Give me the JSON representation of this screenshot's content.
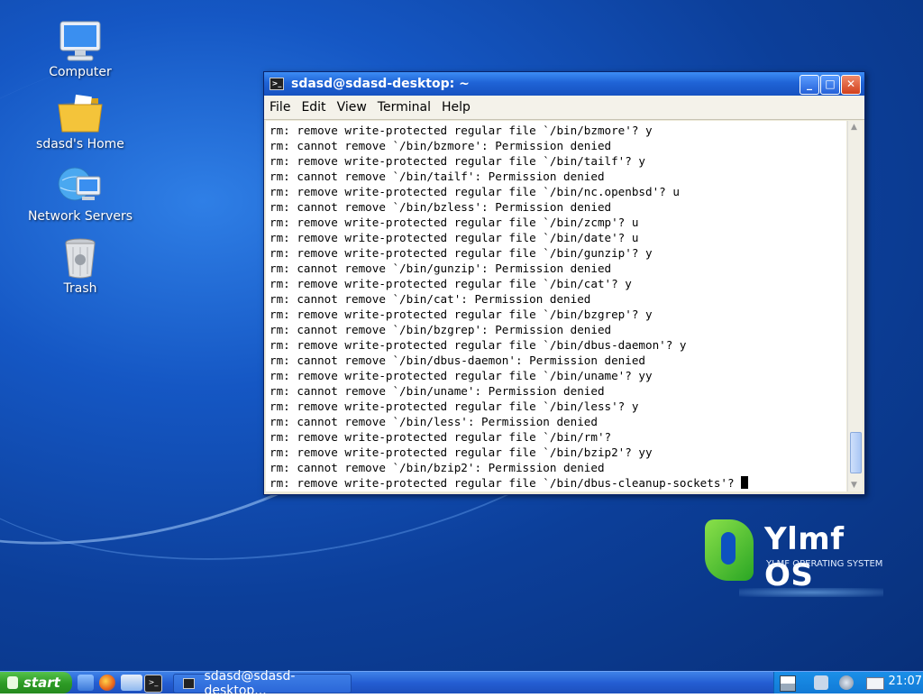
{
  "desktop": {
    "icons": [
      {
        "label": "Computer"
      },
      {
        "label": "sdasd's Home"
      },
      {
        "label": "Network Servers"
      },
      {
        "label": "Trash"
      }
    ]
  },
  "window": {
    "title": "sdasd@sdasd-desktop: ~",
    "menu": [
      "File",
      "Edit",
      "View",
      "Terminal",
      "Help"
    ],
    "buttons": {
      "minimize": "_",
      "maximize": "□",
      "close": "✕"
    }
  },
  "terminal": {
    "lines": [
      "rm: remove write-protected regular file `/bin/bzmore'? y",
      "rm: cannot remove `/bin/bzmore': Permission denied",
      "rm: remove write-protected regular file `/bin/tailf'? y",
      "rm: cannot remove `/bin/tailf': Permission denied",
      "rm: remove write-protected regular file `/bin/nc.openbsd'? u",
      "rm: cannot remove `/bin/bzless': Permission denied",
      "rm: remove write-protected regular file `/bin/zcmp'? u",
      "rm: remove write-protected regular file `/bin/date'? u",
      "rm: remove write-protected regular file `/bin/gunzip'? y",
      "rm: cannot remove `/bin/gunzip': Permission denied",
      "rm: remove write-protected regular file `/bin/cat'? y",
      "rm: cannot remove `/bin/cat': Permission denied",
      "rm: remove write-protected regular file `/bin/bzgrep'? y",
      "rm: cannot remove `/bin/bzgrep': Permission denied",
      "rm: remove write-protected regular file `/bin/dbus-daemon'? y",
      "rm: cannot remove `/bin/dbus-daemon': Permission denied",
      "rm: remove write-protected regular file `/bin/uname'? yy",
      "rm: cannot remove `/bin/uname': Permission denied",
      "rm: remove write-protected regular file `/bin/less'? y",
      "rm: cannot remove `/bin/less': Permission denied",
      "rm: remove write-protected regular file `/bin/rm'?",
      "rm: remove write-protected regular file `/bin/bzip2'? yy",
      "rm: cannot remove `/bin/bzip2': Permission denied",
      "rm: remove write-protected regular file `/bin/dbus-cleanup-sockets'? "
    ]
  },
  "logo": {
    "title": "Ylmf OS",
    "subtitle": "YLMF OPERATING SYSTEM"
  },
  "taskbar": {
    "start_label": "start",
    "task_title": "sdasd@sdasd-desktop...",
    "clock": "21:07"
  },
  "colors": {
    "accent": "#1f63d6",
    "start_green": "#2d9a25",
    "desktop_blue": "#1557c4"
  }
}
